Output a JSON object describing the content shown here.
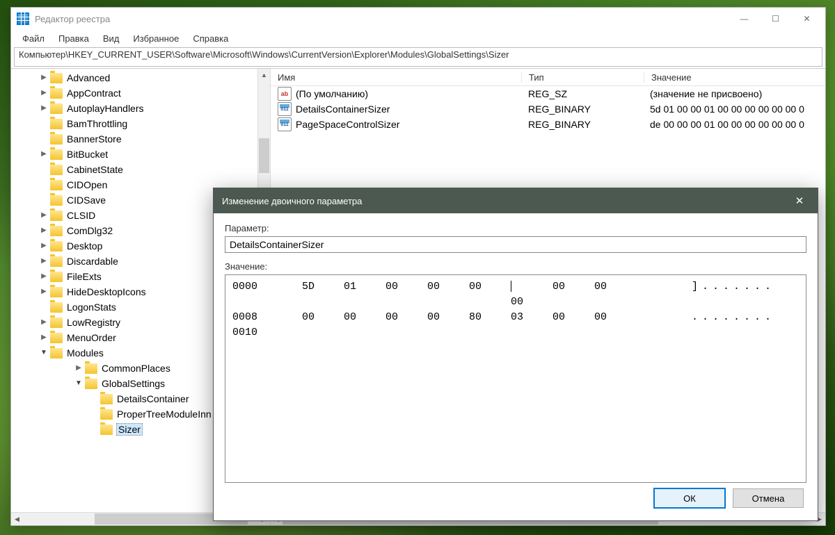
{
  "window": {
    "title": "Редактор реестра",
    "minimize": "—",
    "maximize": "☐",
    "close": "✕"
  },
  "menu": [
    "Файл",
    "Правка",
    "Вид",
    "Избранное",
    "Справка"
  ],
  "address": "Компьютер\\HKEY_CURRENT_USER\\Software\\Microsoft\\Windows\\CurrentVersion\\Explorer\\Modules\\GlobalSettings\\Sizer",
  "tree": [
    {
      "depth": 1,
      "exp": ">",
      "label": "Advanced"
    },
    {
      "depth": 1,
      "exp": ">",
      "label": "AppContract"
    },
    {
      "depth": 1,
      "exp": ">",
      "label": "AutoplayHandlers"
    },
    {
      "depth": 1,
      "exp": "",
      "label": "BamThrottling"
    },
    {
      "depth": 1,
      "exp": "",
      "label": "BannerStore"
    },
    {
      "depth": 1,
      "exp": ">",
      "label": "BitBucket"
    },
    {
      "depth": 1,
      "exp": "",
      "label": "CabinetState"
    },
    {
      "depth": 1,
      "exp": "",
      "label": "CIDOpen"
    },
    {
      "depth": 1,
      "exp": "",
      "label": "CIDSave"
    },
    {
      "depth": 1,
      "exp": ">",
      "label": "CLSID"
    },
    {
      "depth": 1,
      "exp": ">",
      "label": "ComDlg32"
    },
    {
      "depth": 1,
      "exp": ">",
      "label": "Desktop"
    },
    {
      "depth": 1,
      "exp": ">",
      "label": "Discardable"
    },
    {
      "depth": 1,
      "exp": ">",
      "label": "FileExts"
    },
    {
      "depth": 1,
      "exp": ">",
      "label": "HideDesktopIcons"
    },
    {
      "depth": 1,
      "exp": "",
      "label": "LogonStats"
    },
    {
      "depth": 1,
      "exp": ">",
      "label": "LowRegistry"
    },
    {
      "depth": 1,
      "exp": ">",
      "label": "MenuOrder"
    },
    {
      "depth": 1,
      "exp": "v",
      "label": "Modules"
    },
    {
      "depth": 2,
      "exp": ">",
      "label": "CommonPlaces"
    },
    {
      "depth": 2,
      "exp": "v",
      "label": "GlobalSettings"
    },
    {
      "depth": 3,
      "exp": "",
      "label": "DetailsContainer"
    },
    {
      "depth": 3,
      "exp": "",
      "label": "ProperTreeModuleInn"
    },
    {
      "depth": 3,
      "exp": "",
      "label": "Sizer",
      "sel": true
    }
  ],
  "list": {
    "headers": {
      "name": "Имя",
      "type": "Тип",
      "value": "Значение"
    },
    "rows": [
      {
        "icon": "str",
        "iconText": "ab",
        "name": "(По умолчанию)",
        "type": "REG_SZ",
        "value": "(значение не присвоено)"
      },
      {
        "icon": "bin",
        "iconText": "011",
        "name": "DetailsContainerSizer",
        "type": "REG_BINARY",
        "value": "5d 01 00 00 01 00 00 00 00 00 00 0"
      },
      {
        "icon": "bin",
        "iconText": "011",
        "name": "PageSpaceControlSizer",
        "type": "REG_BINARY",
        "value": "de 00 00 00 01 00 00 00 00 00 00 0"
      }
    ]
  },
  "dialog": {
    "title": "Изменение двоичного параметра",
    "paramLabel": "Параметр:",
    "paramValue": "DetailsContainerSizer",
    "valueLabel": "Значение:",
    "hex": [
      {
        "off": "0000",
        "b": [
          "5D",
          "01",
          "00",
          "00",
          "00",
          "00",
          "00",
          "00"
        ],
        "asc": "]......."
      },
      {
        "off": "0008",
        "b": [
          "00",
          "00",
          "00",
          "00",
          "80",
          "03",
          "00",
          "00"
        ],
        "asc": "........"
      },
      {
        "off": "0010",
        "b": [
          "",
          "",
          "",
          "",
          "",
          "",
          "",
          ""
        ],
        "asc": ""
      }
    ],
    "ok": "ОК",
    "cancel": "Отмена"
  }
}
